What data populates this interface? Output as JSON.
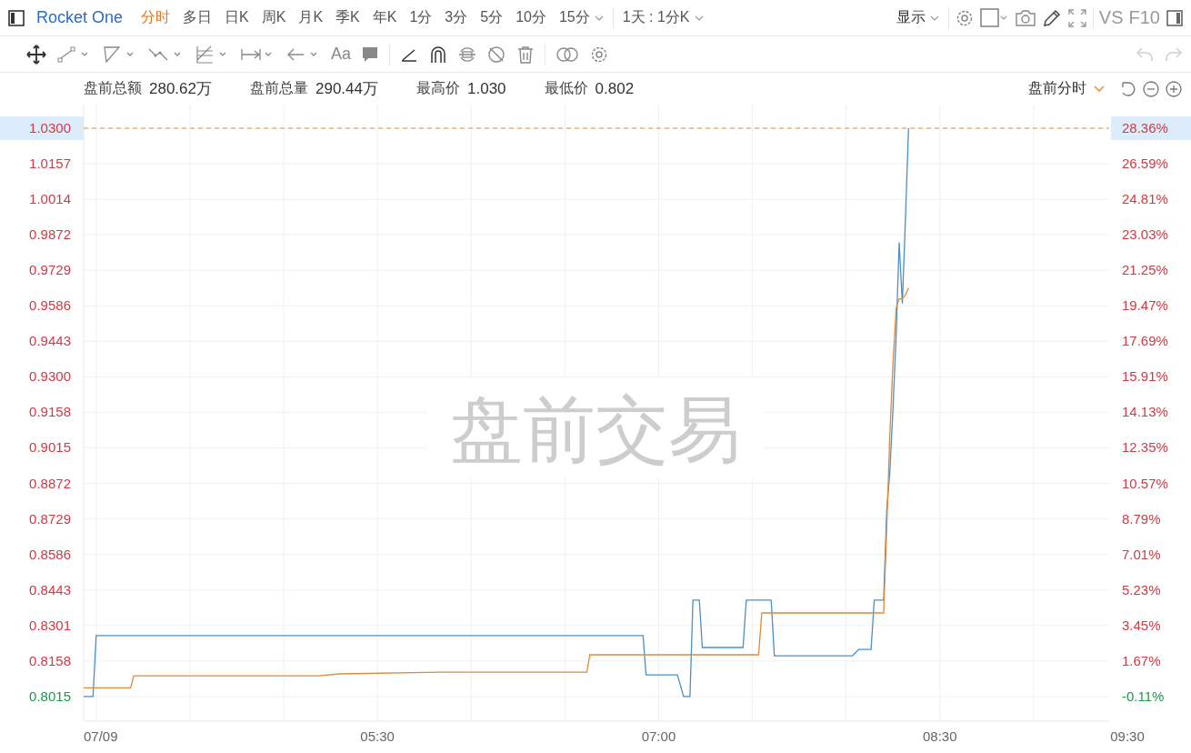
{
  "toolbar": {
    "symbol": "Rocket One",
    "periods": [
      {
        "label": "分时",
        "selected": true,
        "dropdown": false
      },
      {
        "label": "多日",
        "selected": false,
        "dropdown": false
      },
      {
        "label": "日K",
        "selected": false,
        "dropdown": false
      },
      {
        "label": "周K",
        "selected": false,
        "dropdown": false
      },
      {
        "label": "月K",
        "selected": false,
        "dropdown": false
      },
      {
        "label": "季K",
        "selected": false,
        "dropdown": false
      },
      {
        "label": "年K",
        "selected": false,
        "dropdown": false
      },
      {
        "label": "1分",
        "selected": false,
        "dropdown": false
      },
      {
        "label": "3分",
        "selected": false,
        "dropdown": false
      },
      {
        "label": "5分",
        "selected": false,
        "dropdown": false
      },
      {
        "label": "10分",
        "selected": false,
        "dropdown": false
      },
      {
        "label": "15分",
        "selected": false,
        "dropdown": true
      }
    ],
    "range": "1天 : 1分K",
    "display": "显示",
    "vs": "VS",
    "f10": "F10"
  },
  "drawing_tools": {
    "text_tool": "Aa",
    "undo_disabled": true,
    "redo_disabled": true
  },
  "stats": [
    {
      "label": "盘前总额",
      "value": "280.62万"
    },
    {
      "label": "盘前总量",
      "value": "290.44万"
    },
    {
      "label": "最高价",
      "value": "1.030"
    },
    {
      "label": "最低价",
      "value": "0.802"
    }
  ],
  "chart_mode": "盘前分时",
  "watermark": "盘前交易",
  "price_scale": [
    {
      "color": "#cf3a45",
      "highlighted": true
    },
    {
      "color": "#cf3a45",
      "highlighted": false
    },
    {
      "color": "#cf3a45",
      "highlighted": false
    },
    {
      "color": "#cf3a45",
      "highlighted": false
    },
    {
      "color": "#cf3a45",
      "highlighted": false
    },
    {
      "color": "#cf3a45",
      "highlighted": false
    },
    {
      "color": "#cf3a45",
      "highlighted": false
    },
    {
      "color": "#cf3a45",
      "highlighted": false
    },
    {
      "color": "#cf3a45",
      "highlighted": false
    },
    {
      "color": "#cf3a45",
      "highlighted": false
    },
    {
      "color": "#cf3a45",
      "highlighted": false
    },
    {
      "color": "#cf3a45",
      "highlighted": false
    },
    {
      "color": "#cf3a45",
      "highlighted": false
    },
    {
      "color": "#cf3a45",
      "highlighted": false
    },
    {
      "color": "#cf3a45",
      "highlighted": false
    },
    {
      "color": "#cf3a45",
      "highlighted": false
    },
    {
      "color": "#1c9a4c",
      "highlighted": false
    }
  ],
  "percent_scale": [
    {
      "label": "28.36%",
      "color": "#cf3a45",
      "highlighted": true
    },
    {
      "label": "26.59%",
      "color": "#cf3a45",
      "highlighted": false
    },
    {
      "label": "24.81%",
      "color": "#cf3a45",
      "highlighted": false
    },
    {
      "label": "23.03%",
      "color": "#cf3a45",
      "highlighted": false
    },
    {
      "label": "21.25%",
      "color": "#cf3a45",
      "highlighted": false
    },
    {
      "label": "19.47%",
      "color": "#cf3a45",
      "highlighted": false
    },
    {
      "label": "17.69%",
      "color": "#cf3a45",
      "highlighted": false
    },
    {
      "label": "15.91%",
      "color": "#cf3a45",
      "highlighted": false
    },
    {
      "label": "14.13%",
      "color": "#cf3a45",
      "highlighted": false
    },
    {
      "label": "12.35%",
      "color": "#cf3a45",
      "highlighted": false
    },
    {
      "label": "10.57%",
      "color": "#cf3a45",
      "highlighted": false
    },
    {
      "label": "8.79%",
      "color": "#cf3a45",
      "highlighted": false
    },
    {
      "label": "7.01%",
      "color": "#cf3a45",
      "highlighted": false
    },
    {
      "label": "5.23%",
      "color": "#cf3a45",
      "highlighted": false
    },
    {
      "label": "3.45%",
      "color": "#cf3a45",
      "highlighted": false
    },
    {
      "label": "1.67%",
      "color": "#cf3a45",
      "highlighted": false
    },
    {
      "label": "-0.11%",
      "color": "#1c9a4c",
      "highlighted": false
    }
  ],
  "chart_data": {
    "type": "line",
    "x": [
      3.933,
      3.983,
      4,
      4.183,
      4.2,
      5.183,
      5.3,
      5.833,
      6.617,
      6.633,
      6.917,
      6.933,
      7.1,
      7.133,
      7.167,
      7.183,
      7.217,
      7.233,
      7.45,
      7.467,
      7.533,
      7.55,
      7.6,
      7.617,
      8.033,
      8.067,
      8.133,
      8.15,
      8.2,
      8.217,
      8.233,
      8.25,
      8.267,
      8.283,
      8.3,
      8.317,
      8.333
    ],
    "series": [
      {
        "color": "#4a90c8",
        "values": [
          0.8015,
          0.8015,
          0.826,
          0.826,
          0.826,
          0.826,
          0.826,
          0.826,
          0.826,
          0.826,
          0.826,
          0.8102,
          0.8102,
          0.8015,
          0.8015,
          0.8403,
          0.8403,
          0.8212,
          0.8212,
          0.8403,
          0.8403,
          0.8403,
          0.8403,
          0.8179,
          0.8179,
          0.8204,
          0.8204,
          0.8403,
          0.8403,
          0.877,
          0.8916,
          0.9173,
          0.9467,
          0.9841,
          0.9595,
          0.9944,
          1.03
        ]
      },
      {
        "color": "#e08a3c",
        "values": [
          0.805,
          0.805,
          0.805,
          0.805,
          0.8098,
          0.8098,
          0.8106,
          0.8113,
          0.8113,
          0.8183,
          0.8183,
          0.8183,
          0.8183,
          0.8183,
          0.8183,
          0.8183,
          0.8183,
          0.8183,
          0.8183,
          0.8183,
          0.8183,
          0.8351,
          0.8351,
          0.8351,
          0.8351,
          0.8351,
          0.8351,
          0.8351,
          0.8351,
          0.87,
          0.9063,
          0.9357,
          0.9577,
          0.9614,
          0.9614,
          0.963,
          0.9658
        ]
      }
    ],
    "grid": true,
    "ref_lines": [
      {
        "axis": "y",
        "value": 1.03,
        "color": "#e8903a"
      }
    ],
    "xlim": [
      3.933,
      9.5
    ],
    "ylim": [
      0.7916,
      1.0395
    ],
    "xticks": [
      {
        "value": 3.933,
        "label": "07/09"
      },
      {
        "value": 5.5,
        "label": "05:30"
      },
      {
        "value": 7,
        "label": "07:00"
      },
      {
        "value": 8.5,
        "label": "08:30"
      },
      {
        "value": 9.5,
        "label": "09:30"
      }
    ],
    "yticks": [
      {
        "value": 1.03,
        "label": "1.0300"
      },
      {
        "value": 1.0157,
        "label": "1.0157"
      },
      {
        "value": 1.0014,
        "label": "1.0014"
      },
      {
        "value": 0.9872,
        "label": "0.9872"
      },
      {
        "value": 0.9729,
        "label": "0.9729"
      },
      {
        "value": 0.9586,
        "label": "0.9586"
      },
      {
        "value": 0.9443,
        "label": "0.9443"
      },
      {
        "value": 0.93,
        "label": "0.9300"
      },
      {
        "value": 0.9158,
        "label": "0.9158"
      },
      {
        "value": 0.9015,
        "label": "0.9015"
      },
      {
        "value": 0.8872,
        "label": "0.8872"
      },
      {
        "value": 0.8729,
        "label": "0.8729"
      },
      {
        "value": 0.8586,
        "label": "0.8586"
      },
      {
        "value": 0.8443,
        "label": "0.8443"
      },
      {
        "value": 0.8301,
        "label": "0.8301"
      },
      {
        "value": 0.8158,
        "label": "0.8158"
      },
      {
        "value": 0.8015,
        "label": "0.8015"
      }
    ]
  }
}
